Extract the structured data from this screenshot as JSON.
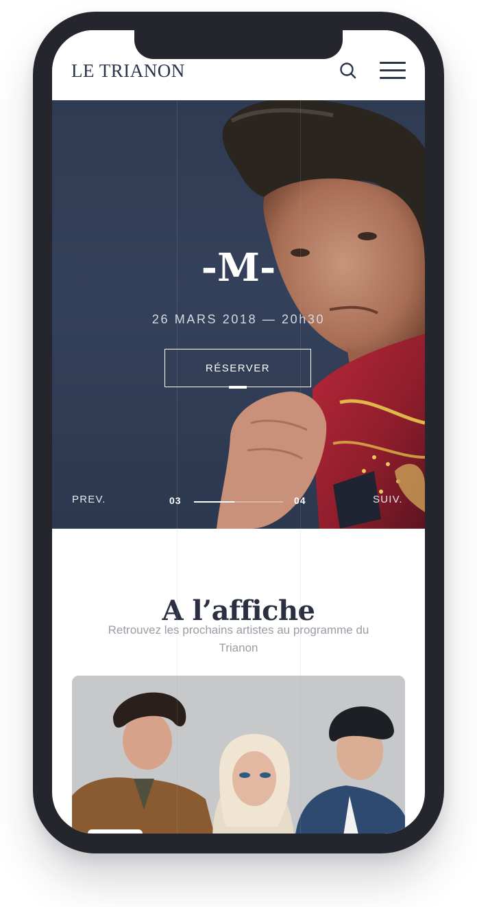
{
  "header": {
    "logo": "LE TRIANON",
    "search_icon": "search-icon",
    "menu_icon": "hamburger-menu-icon"
  },
  "hero": {
    "title": "-M-",
    "date": "26 MARS 2018 — 20h30",
    "cta": "RÉSERVER",
    "prev": "PREV.",
    "next": "SUIV.",
    "current": "03",
    "total": "04",
    "progress": 0.45
  },
  "section": {
    "title": "A l’affiche",
    "subtitle": "Retrouvez les prochains artistes au programme du Trianon"
  },
  "colors": {
    "navy": "#2a3347",
    "hero_bg": "#323e56",
    "phone_frame": "#24252d",
    "muted_text": "#9a9ca4"
  }
}
